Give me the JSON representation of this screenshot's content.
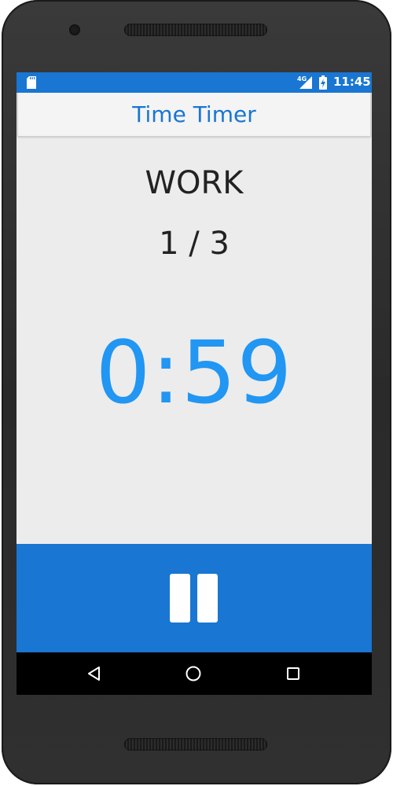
{
  "status_bar": {
    "network": "4G",
    "time": "11:45",
    "icons": [
      "sd-card-icon",
      "signal-icon",
      "battery-charging-icon"
    ]
  },
  "app_bar": {
    "title": "Time Timer"
  },
  "timer": {
    "phase": "WORK",
    "round": "1 / 3",
    "remaining": "0:59"
  },
  "controls": {
    "primary_icon": "pause-icon"
  },
  "nav_bar": {
    "icons": [
      "back-icon",
      "home-icon",
      "recents-icon"
    ]
  },
  "colors": {
    "primary": "#1976d2",
    "timer_text": "#2196f3",
    "background": "#ececec"
  }
}
